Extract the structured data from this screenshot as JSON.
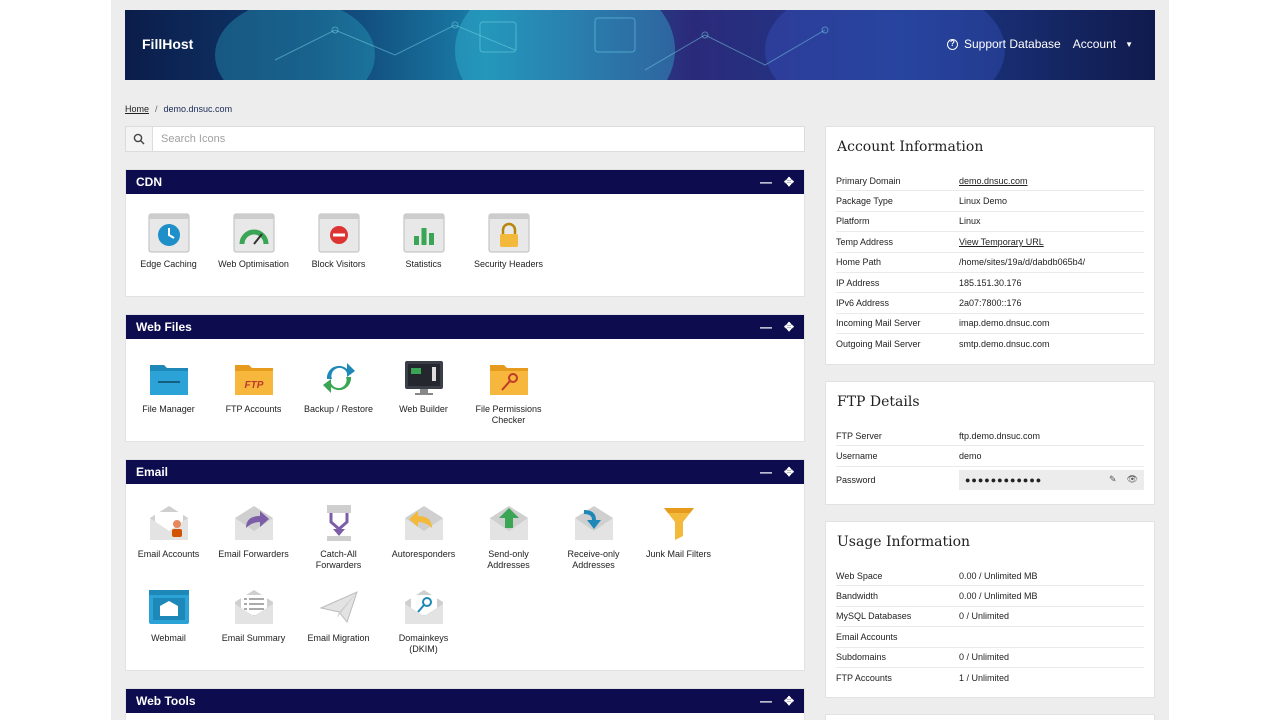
{
  "header": {
    "brand": "FillHost",
    "support": "Support Database",
    "account": "Account"
  },
  "breadcrumb": {
    "home": "Home",
    "separator": "/",
    "current": "demo.dnsuc.com"
  },
  "search": {
    "placeholder": "Search Icons"
  },
  "panels": [
    {
      "title": "CDN",
      "items": [
        {
          "label": "Edge Caching",
          "icon": "clock-icon"
        },
        {
          "label": "Web Optimisation",
          "icon": "speed-gauge-icon"
        },
        {
          "label": "Block Visitors",
          "icon": "block-icon"
        },
        {
          "label": "Statistics",
          "icon": "bar-chart-icon"
        },
        {
          "label": "Security Headers",
          "icon": "lock-icon"
        }
      ]
    },
    {
      "title": "Web Files",
      "items": [
        {
          "label": "File Manager",
          "icon": "folder-icon"
        },
        {
          "label": "FTP Accounts",
          "icon": "ftp-folder-icon"
        },
        {
          "label": "Backup / Restore",
          "icon": "backup-arrows-icon"
        },
        {
          "label": "Web Builder",
          "icon": "monitor-icon"
        },
        {
          "label": "File Permissions Checker",
          "icon": "key-folder-icon"
        }
      ]
    },
    {
      "title": "Email",
      "items": [
        {
          "label": "Email Accounts",
          "icon": "envelope-user-icon"
        },
        {
          "label": "Email Forwarders",
          "icon": "envelope-forward-icon"
        },
        {
          "label": "Catch-All Forwarders",
          "icon": "catch-all-icon"
        },
        {
          "label": "Autoresponders",
          "icon": "envelope-reply-icon"
        },
        {
          "label": "Send-only Addresses",
          "icon": "envelope-up-icon"
        },
        {
          "label": "Receive-only Addresses",
          "icon": "envelope-down-icon"
        },
        {
          "label": "Junk Mail Filters",
          "icon": "funnel-icon"
        },
        {
          "label": "Webmail",
          "icon": "webmail-icon"
        },
        {
          "label": "Email Summary",
          "icon": "envelope-list-icon"
        },
        {
          "label": "Email Migration",
          "icon": "paper-plane-icon"
        },
        {
          "label": "Domainkeys (DKIM)",
          "icon": "envelope-key-icon"
        }
      ]
    },
    {
      "title": "Web Tools",
      "items": []
    }
  ],
  "account_info": {
    "title": "Account Information",
    "rows": [
      {
        "k": "Primary Domain",
        "v": "demo.dnsuc.com"
      },
      {
        "k": "Package Type",
        "v": "Linux Demo"
      },
      {
        "k": "Platform",
        "v": "Linux"
      },
      {
        "k": "Temp Address",
        "v": "View Temporary URL"
      },
      {
        "k": "Home Path",
        "v": "/home/sites/19a/d/dabdb065b4/"
      },
      {
        "k": "IP Address",
        "v": "185.151.30.176"
      },
      {
        "k": "IPv6 Address",
        "v": "2a07:7800::176"
      },
      {
        "k": "Incoming Mail Server",
        "v": "imap.demo.dnsuc.com"
      },
      {
        "k": "Outgoing Mail Server",
        "v": "smtp.demo.dnsuc.com"
      }
    ]
  },
  "ftp_details": {
    "title": "FTP Details",
    "rows": [
      {
        "k": "FTP Server",
        "v": "ftp.demo.dnsuc.com"
      },
      {
        "k": "Username",
        "v": "demo"
      }
    ],
    "password_label": "Password",
    "password_mask": "●●●●●●●●●●●●"
  },
  "usage": {
    "title": "Usage Information",
    "rows": [
      {
        "k": "Web Space",
        "v": "0.00 / Unlimited MB"
      },
      {
        "k": "Bandwidth",
        "v": "0.00 / Unlimited MB"
      },
      {
        "k": "MySQL Databases",
        "v": "0 / Unlimited"
      },
      {
        "k": "Email Accounts",
        "v": ""
      },
      {
        "k": "Subdomains",
        "v": "0 / Unlimited"
      },
      {
        "k": "FTP Accounts",
        "v": "1 / Unlimited"
      }
    ]
  },
  "colors": {
    "panel_header": "#0c0c4e",
    "accent": "#1a2a55"
  }
}
